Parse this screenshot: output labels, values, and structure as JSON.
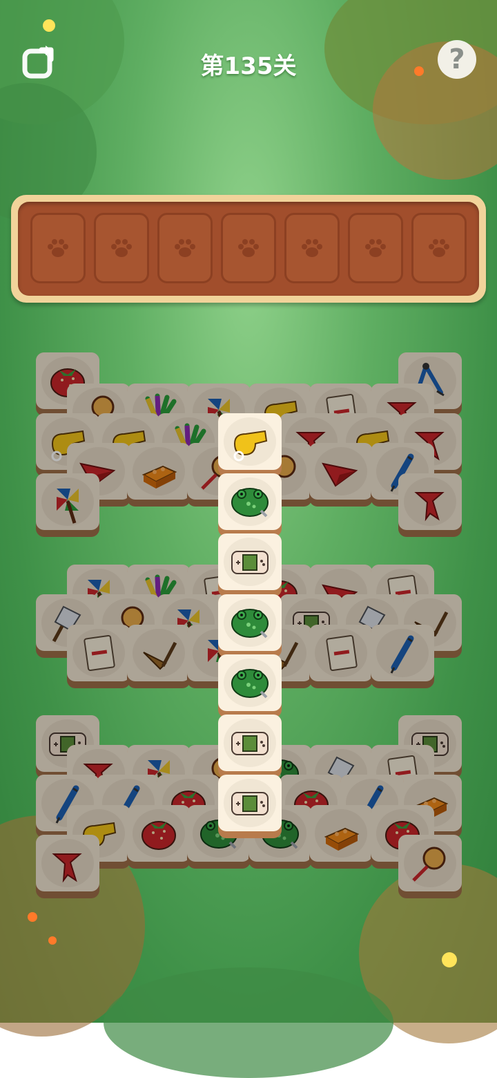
{
  "level": {
    "title": "第135关"
  },
  "topbar": {
    "restart_icon": "restart-icon",
    "help_label": "?"
  },
  "tray": {
    "slot_count": 7,
    "slot_icon": "paw-icon",
    "filled": []
  },
  "colors": {
    "tray_frame": "#f1d39a",
    "tray_bg": "#a14e2c",
    "tile_face": "#efe3d0",
    "tile_base": "#9c6d47",
    "bg_green": "#5fae62"
  },
  "tiles": [
    {
      "item": "strawberry",
      "dim": true
    },
    {
      "item": "compass",
      "dim": true
    },
    {
      "item": "rattle-drum",
      "dim": true
    },
    {
      "item": "feather-fan",
      "dim": true
    },
    {
      "item": "pinwheel",
      "dim": true
    },
    {
      "item": "whistle",
      "dim": true
    },
    {
      "item": "notebook",
      "dim": true
    },
    {
      "item": "red-scarf",
      "dim": true
    },
    {
      "item": "whistle",
      "dim": true
    },
    {
      "item": "red-scarf",
      "dim": true
    },
    {
      "item": "whistle",
      "dim": true
    },
    {
      "item": "feather-fan",
      "dim": true
    },
    {
      "item": "red-scarf",
      "dim": true
    },
    {
      "item": "whistle",
      "dim": true
    },
    {
      "item": "paper-plane",
      "dim": true
    },
    {
      "item": "building-brick",
      "dim": true
    },
    {
      "item": "rattle-drum",
      "dim": true
    },
    {
      "item": "rattle-drum",
      "dim": true
    },
    {
      "item": "paper-plane",
      "dim": true
    },
    {
      "item": "pen",
      "dim": true
    },
    {
      "item": "pinwheel",
      "dim": true
    },
    {
      "item": "red-scarf",
      "dim": true
    },
    {
      "item": "pinwheel",
      "dim": true
    },
    {
      "item": "feather-fan",
      "dim": true
    },
    {
      "item": "notebook",
      "dim": true
    },
    {
      "item": "strawberry",
      "dim": true
    },
    {
      "item": "paper-plane",
      "dim": true
    },
    {
      "item": "notebook",
      "dim": true
    },
    {
      "item": "trowel",
      "dim": true
    },
    {
      "item": "broom",
      "dim": true
    },
    {
      "item": "rattle-drum",
      "dim": true
    },
    {
      "item": "pinwheel",
      "dim": true
    },
    {
      "item": "game-console",
      "dim": true
    },
    {
      "item": "trowel",
      "dim": true
    },
    {
      "item": "notebook",
      "dim": true
    },
    {
      "item": "broom",
      "dim": true
    },
    {
      "item": "pinwheel",
      "dim": true
    },
    {
      "item": "broom",
      "dim": true
    },
    {
      "item": "notebook",
      "dim": true
    },
    {
      "item": "pen",
      "dim": true
    },
    {
      "item": "game-console",
      "dim": true
    },
    {
      "item": "game-console",
      "dim": true
    },
    {
      "item": "red-scarf",
      "dim": true
    },
    {
      "item": "pinwheel",
      "dim": true
    },
    {
      "item": "rattle-drum",
      "dim": true
    },
    {
      "item": "frog",
      "dim": true
    },
    {
      "item": "trowel",
      "dim": true
    },
    {
      "item": "notebook",
      "dim": true
    },
    {
      "item": "pen",
      "dim": true
    },
    {
      "item": "building-brick",
      "dim": true
    },
    {
      "item": "pen",
      "dim": true
    },
    {
      "item": "strawberry",
      "dim": true
    },
    {
      "item": "strawberry",
      "dim": true
    },
    {
      "item": "pen",
      "dim": true
    },
    {
      "item": "whistle",
      "dim": true
    },
    {
      "item": "strawberry",
      "dim": true
    },
    {
      "item": "frog",
      "dim": true
    },
    {
      "item": "frog",
      "dim": true
    },
    {
      "item": "building-brick",
      "dim": true
    },
    {
      "item": "strawberry",
      "dim": true
    },
    {
      "item": "red-scarf",
      "dim": true
    },
    {
      "item": "rattle-drum",
      "dim": true
    },
    {
      "item": "whistle",
      "dim": false
    },
    {
      "item": "frog",
      "dim": false
    },
    {
      "item": "game-console",
      "dim": false
    },
    {
      "item": "frog",
      "dim": false
    },
    {
      "item": "frog",
      "dim": false
    },
    {
      "item": "game-console",
      "dim": false
    },
    {
      "item": "game-console",
      "dim": false
    }
  ]
}
